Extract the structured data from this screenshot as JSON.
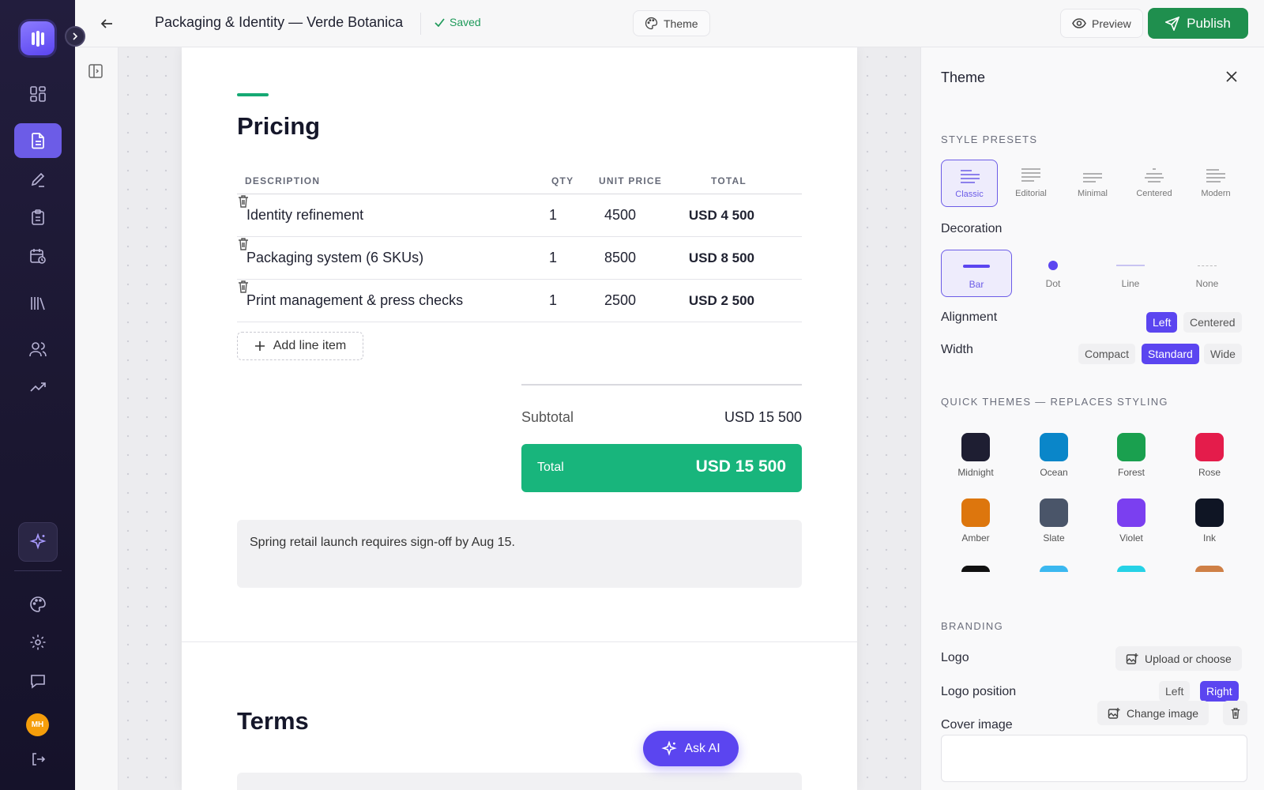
{
  "header": {
    "title": "Packaging & Identity — Verde Botanica",
    "saved_label": "Saved",
    "theme_label": "Theme",
    "preview_label": "Preview",
    "publish_label": "Publish"
  },
  "rail": {
    "avatar_initials": "MH",
    "icons": [
      "dashboard-icon",
      "document-icon",
      "pen-icon",
      "clipboard-icon",
      "calendar-clock-icon",
      "library-icon",
      "users-icon",
      "trending-icon",
      "ai-sparkle-icon",
      "palette-icon",
      "settings-icon",
      "chat-icon",
      "logout-icon"
    ]
  },
  "document": {
    "pricing_title": "Pricing",
    "table": {
      "headers": [
        "DESCRIPTION",
        "QTY",
        "UNIT PRICE",
        "TOTAL"
      ],
      "rows": [
        {
          "description": "Identity refinement",
          "qty": "1",
          "unit_price": "4500",
          "total": "USD 4 500"
        },
        {
          "description": "Packaging system (6 SKUs)",
          "qty": "1",
          "unit_price": "8500",
          "total": "USD 8 500"
        },
        {
          "description": "Print management & press checks",
          "qty": "1",
          "unit_price": "2500",
          "total": "USD 2 500"
        }
      ]
    },
    "add_line_label": "Add line item",
    "subtotal_label": "Subtotal",
    "subtotal_value": "USD 15 500",
    "total_label": "Total",
    "total_value": "USD 15 500",
    "note": "Spring retail launch requires sign-off by Aug 15.",
    "terms_title": "Terms"
  },
  "ask_ai_label": "Ask AI",
  "theme_panel": {
    "title": "Theme",
    "style_presets_label": "STYLE PRESETS",
    "presets": [
      "Classic",
      "Editorial",
      "Minimal",
      "Centered",
      "Modern"
    ],
    "selected_preset": "Classic",
    "decoration_label": "Decoration",
    "decorations": [
      "Bar",
      "Dot",
      "Line",
      "None"
    ],
    "selected_decoration": "Bar",
    "alignment_label": "Alignment",
    "alignment_options": [
      "Left",
      "Centered"
    ],
    "selected_alignment": "Left",
    "width_label": "Width",
    "width_options": [
      "Compact",
      "Standard",
      "Wide"
    ],
    "selected_width": "Standard",
    "quick_themes_label": "QUICK THEMES — REPLACES STYLING",
    "quick_themes": [
      {
        "name": "Midnight",
        "color": "#1e1e32"
      },
      {
        "name": "Ocean",
        "color": "#0a86c9"
      },
      {
        "name": "Forest",
        "color": "#1aa04f"
      },
      {
        "name": "Rose",
        "color": "#e41c4b"
      },
      {
        "name": "Amber",
        "color": "#dd760d"
      },
      {
        "name": "Slate",
        "color": "#4a5569"
      },
      {
        "name": "Violet",
        "color": "#7b3ff0"
      },
      {
        "name": "Ink",
        "color": "#0f1524"
      },
      {
        "name": "",
        "color": "#111111"
      },
      {
        "name": "",
        "color": "#3bb8f0"
      },
      {
        "name": "",
        "color": "#26d2e6"
      },
      {
        "name": "",
        "color": "#cf8046"
      }
    ],
    "branding_label": "BRANDING",
    "logo_label": "Logo",
    "logo_button": "Upload or choose",
    "logo_position_label": "Logo position",
    "logo_position_options": [
      "Left",
      "Right"
    ],
    "selected_logo_position": "Right",
    "cover_image_label": "Cover image",
    "change_image_label": "Change image"
  },
  "colors": {
    "accent": "#5b45f0",
    "publish": "#1f8f4e",
    "total_bar": "#18b57c"
  }
}
